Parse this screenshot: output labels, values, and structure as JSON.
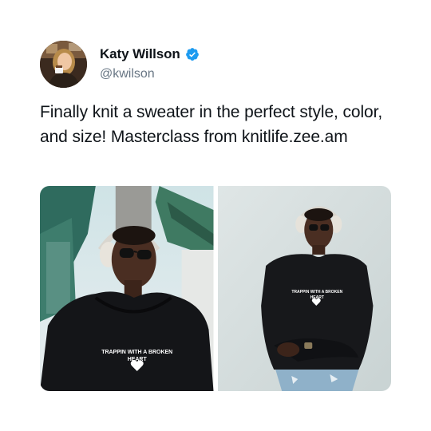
{
  "tweet": {
    "author": {
      "display_name": "Katy Willson",
      "handle": "@kwilson",
      "verified": true,
      "avatar_icon": "user-photo-icon",
      "verified_icon": "verified-badge-icon"
    },
    "text": "Finally knit a sweater in the perfect style, color, and size! Masterclass from knitlife.zee.am",
    "media": [
      {
        "subject": "man in black hoodie with headphones and sunglasses",
        "print_line1": "TRAPPIN WITH A BROKEN",
        "print_line2": "HEART"
      },
      {
        "subject": "man in black hoodie leaning on pale wall",
        "print_line1": "TRAPPIN WITH A BROKEN",
        "print_line2": "HEART"
      }
    ]
  },
  "colors": {
    "text_primary": "#0f1419",
    "text_secondary": "#687684",
    "verified_blue": "#1d9bf0",
    "background": "#ffffff"
  }
}
